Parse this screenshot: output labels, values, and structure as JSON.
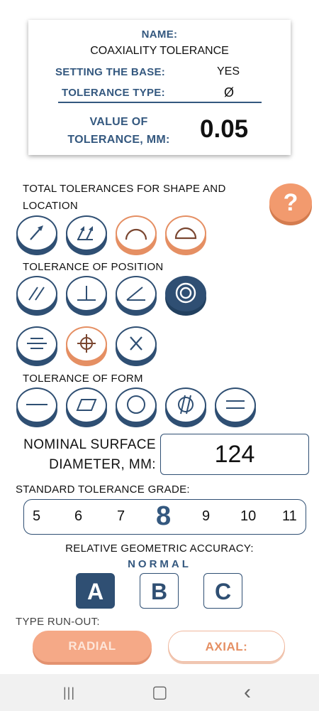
{
  "card": {
    "name_label": "NAME:",
    "name_value": "COAXIALITY TOLERANCE",
    "base_label": "SETTING THE BASE:",
    "base_value": "YES",
    "type_label": "TOLERANCE TYPE:",
    "type_value": "Ø",
    "value_label": "VALUE OF TOLERANCE, MM:",
    "value_value": "0.05"
  },
  "sections": {
    "total": "TOTAL TOLERANCES FOR SHAPE AND LOCATION",
    "position": "TOLERANCE OF POSITION",
    "form": "TOLERANCE OF FORM"
  },
  "help_label": "?",
  "nominal": {
    "label": "NOMINAL SURFACE DIAMETER, MM:",
    "value": "124"
  },
  "grade": {
    "title": "STANDARD TOLERANCE GRADE:",
    "options": [
      "5",
      "6",
      "7",
      "8",
      "9",
      "10",
      "11"
    ],
    "selected": "8"
  },
  "accuracy": {
    "title": "RELATIVE GEOMETRIC ACCURACY:",
    "subtitle": "NORMAL",
    "options": [
      "A",
      "B",
      "C"
    ],
    "selected": "A"
  },
  "runout": {
    "title": "TYPE RUN-OUT:",
    "radial": "RADIAL",
    "axial": "AXIAL:"
  },
  "navbar": {
    "recents": "|||",
    "home": "▢",
    "back": "‹"
  },
  "colors": {
    "primary": "#2f4f73",
    "accent": "#e58f63",
    "label": "#34587f"
  }
}
